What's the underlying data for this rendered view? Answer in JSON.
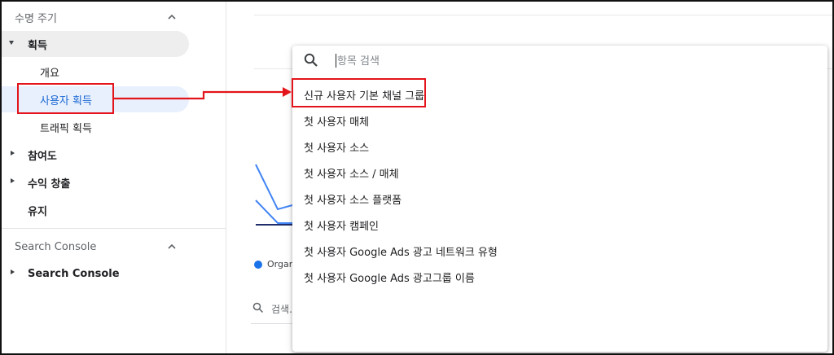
{
  "sidebar": {
    "lifecycle": {
      "title": "수명 주기",
      "items": [
        {
          "label": "획득",
          "state": "expanded"
        },
        {
          "label": "개요"
        },
        {
          "label": "사용자 획득",
          "state": "selected"
        },
        {
          "label": "트래픽 획득"
        },
        {
          "label": "참여도",
          "state": "collapsed"
        },
        {
          "label": "수익 창출",
          "state": "collapsed"
        },
        {
          "label": "유지"
        }
      ]
    },
    "search_console": {
      "title": "Search Console",
      "items": [
        {
          "label": "Search Console",
          "state": "collapsed"
        }
      ]
    }
  },
  "background": {
    "legend_text": "Organ",
    "search_text": "검색..."
  },
  "dropdown": {
    "search": {
      "placeholder": "항목 검색",
      "value": ""
    },
    "options": [
      {
        "label": "신규 사용자 기본 채널 그룹"
      },
      {
        "label": "첫 사용자 매체"
      },
      {
        "label": "첫 사용자 소스"
      },
      {
        "label": "첫 사용자 소스 / 매체"
      },
      {
        "label": "첫 사용자 소스 플랫폼"
      },
      {
        "label": "첫 사용자 캠페인"
      },
      {
        "label": "첫 사용자 Google Ads 광고 네트워크 유형"
      },
      {
        "label": "첫 사용자 Google Ads 광고그룹 이름"
      }
    ]
  },
  "colors": {
    "accent": "#1a73e8",
    "selected_bg": "#e8f0fe",
    "selected_text": "#1967d2",
    "annotation": "#e3141b",
    "chart_line": "#4285f4",
    "chart_line_dark": "#1f2d6b"
  }
}
